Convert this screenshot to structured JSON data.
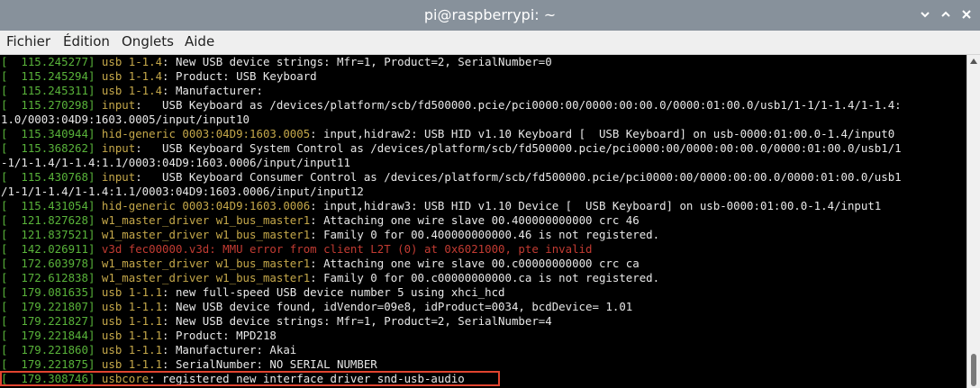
{
  "window": {
    "title": "pi@raspberrypi: ~"
  },
  "menu": {
    "items": [
      "Fichier",
      "Édition",
      "Onglets",
      "Aide"
    ]
  },
  "colors": {
    "timestamp": "#59b33a",
    "source": "#c5a84a",
    "error": "#c23b32",
    "highlight": "#e2442f"
  },
  "terminal": {
    "lines": [
      {
        "ts": "[  115.245277]",
        "src": "usb 1-1.4",
        "msg": ": New USB device strings: Mfr=1, Product=2, SerialNumber=0"
      },
      {
        "ts": "[  115.245294]",
        "src": "usb 1-1.4",
        "msg": ": Product: USB Keyboard"
      },
      {
        "ts": "[  115.245311]",
        "src": "usb 1-1.4",
        "msg": ": Manufacturer:"
      },
      {
        "ts": "[  115.270298]",
        "src": "input",
        "msg": ":   USB Keyboard as /devices/platform/scb/fd500000.pcie/pci0000:00/0000:00:00.0/0000:01:00.0/usb1/1-1/1-1.4/1-1.4:"
      },
      {
        "ts": "",
        "src": "",
        "msg": "1.0/0003:04D9:1603.0005/input/input10"
      },
      {
        "ts": "[  115.340944]",
        "src": "hid-generic 0003:04D9:1603.0005",
        "msg": ": input,hidraw2: USB HID v1.10 Keyboard [  USB Keyboard] on usb-0000:01:00.0-1.4/input0"
      },
      {
        "ts": "[  115.368262]",
        "src": "input",
        "msg": ":   USB Keyboard System Control as /devices/platform/scb/fd500000.pcie/pci0000:00/0000:00:00.0/0000:01:00.0/usb1/1"
      },
      {
        "ts": "",
        "src": "",
        "msg": "-1/1-1.4/1-1.4:1.1/0003:04D9:1603.0006/input/input11"
      },
      {
        "ts": "[  115.430768]",
        "src": "input",
        "msg": ":   USB Keyboard Consumer Control as /devices/platform/scb/fd500000.pcie/pci0000:00/0000:00:00.0/0000:01:00.0/usb1"
      },
      {
        "ts": "",
        "src": "",
        "msg": "/1-1/1-1.4/1-1.4:1.1/0003:04D9:1603.0006/input/input12"
      },
      {
        "ts": "[  115.431054]",
        "src": "hid-generic 0003:04D9:1603.0006",
        "msg": ": input,hidraw3: USB HID v1.10 Device [  USB Keyboard] on usb-0000:01:00.0-1.4/input1"
      },
      {
        "ts": "[  121.827628]",
        "src": "w1_master_driver w1_bus_master1",
        "msg": ": Attaching one wire slave 00.400000000000 crc 46"
      },
      {
        "ts": "[  121.837521]",
        "src": "w1_master_driver w1_bus_master1",
        "msg": ": Family 0 for 00.400000000000.46 is not registered."
      },
      {
        "ts": "[  142.026911]",
        "src": "v3d fec00000.v3d",
        "msg": ": MMU error from client L2T (0) at 0x6021000, pte invalid",
        "error": true
      },
      {
        "ts": "[  172.603978]",
        "src": "w1_master_driver w1_bus_master1",
        "msg": ": Attaching one wire slave 00.c00000000000 crc ca"
      },
      {
        "ts": "[  172.612838]",
        "src": "w1_master_driver w1_bus_master1",
        "msg": ": Family 0 for 00.c00000000000.ca is not registered."
      },
      {
        "ts": "[  179.081635]",
        "src": "usb 1-1.1",
        "msg": ": new full-speed USB device number 5 using xhci_hcd"
      },
      {
        "ts": "[  179.221807]",
        "src": "usb 1-1.1",
        "msg": ": New USB device found, idVendor=09e8, idProduct=0034, bcdDevice= 1.01"
      },
      {
        "ts": "[  179.221827]",
        "src": "usb 1-1.1",
        "msg": ": New USB device strings: Mfr=1, Product=2, SerialNumber=4"
      },
      {
        "ts": "[  179.221844]",
        "src": "usb 1-1.1",
        "msg": ": Product: MPD218"
      },
      {
        "ts": "[  179.221860]",
        "src": "usb 1-1.1",
        "msg": ": Manufacturer: Akai"
      },
      {
        "ts": "[  179.221875]",
        "src": "usb 1-1.1",
        "msg": ": SerialNumber: NO SERIAL NUMBER"
      },
      {
        "ts": "[  179.308746]",
        "src": "usbcore",
        "msg": ": registered new interface driver snd-usb-audio"
      }
    ]
  }
}
